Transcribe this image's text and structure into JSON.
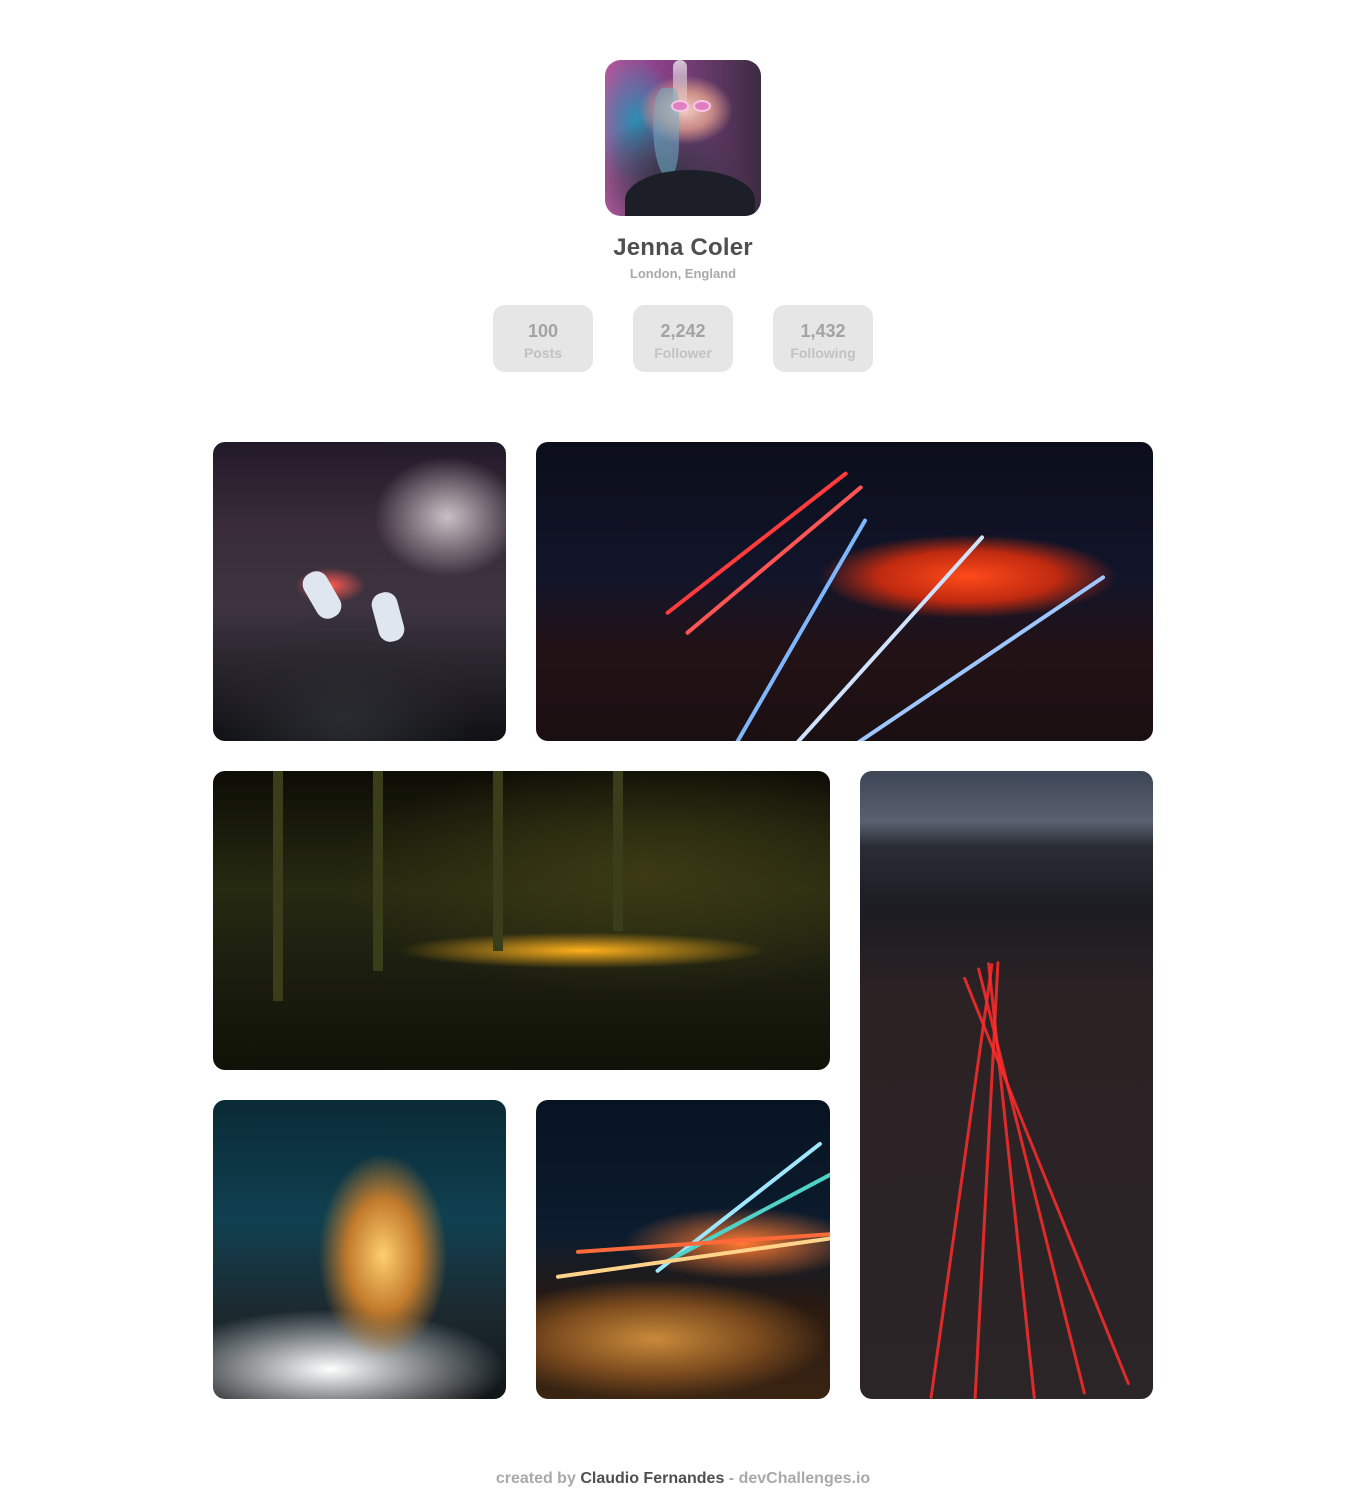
{
  "profile": {
    "name": "Jenna Coler",
    "location": "London, England",
    "stats": [
      {
        "value": "100",
        "label": "Posts"
      },
      {
        "value": "2,242",
        "label": "Follower"
      },
      {
        "value": "1,432",
        "label": "Following"
      }
    ]
  },
  "gallery": [
    {
      "subject": "legs-over-city-street-at-night"
    },
    {
      "subject": "stadium-and-highway-light-trails"
    },
    {
      "subject": "bridge-bus-lane-light-trails"
    },
    {
      "subject": "highway-red-light-trails"
    },
    {
      "subject": "tower-building-light-trails"
    },
    {
      "subject": "street-light-trails-cobblestone"
    }
  ],
  "footer": {
    "prefix": "created by",
    "author": "Claudio Fernandes",
    "separator": "-",
    "site": "devChallenges.io"
  }
}
